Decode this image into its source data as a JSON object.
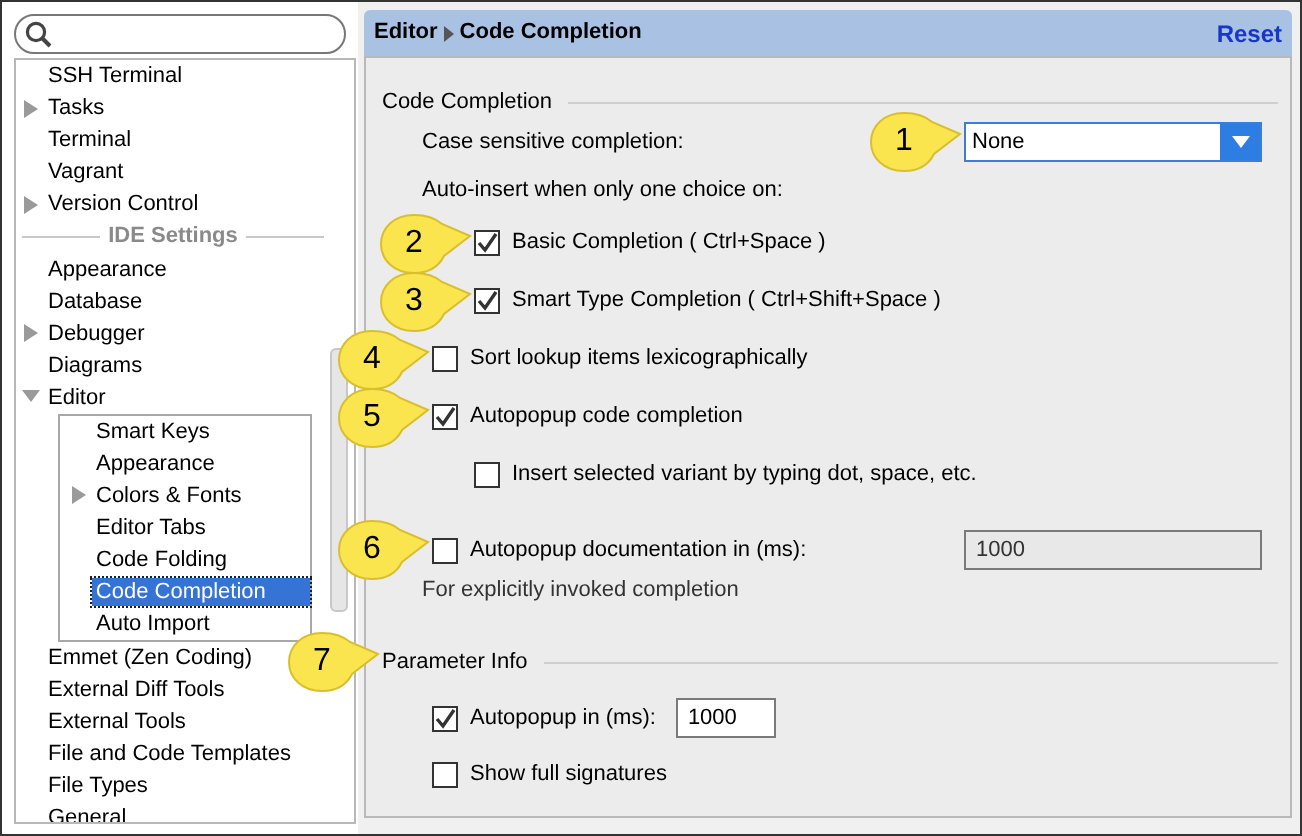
{
  "sidebar": {
    "items": [
      {
        "kind": "item",
        "label": "SSH Terminal",
        "selected": false
      },
      {
        "kind": "item",
        "label": "Tasks",
        "expanded": false,
        "selected": false
      },
      {
        "kind": "item",
        "label": "Terminal",
        "selected": false
      },
      {
        "kind": "item",
        "label": "Vagrant",
        "selected": false
      },
      {
        "kind": "item",
        "label": "Version Control",
        "expanded": false,
        "selected": false
      },
      {
        "kind": "heading",
        "label": "IDE Settings"
      },
      {
        "kind": "item",
        "label": "Appearance",
        "selected": false
      },
      {
        "kind": "item",
        "label": "Database",
        "selected": false
      },
      {
        "kind": "item",
        "label": "Debugger",
        "expanded": false,
        "selected": false
      },
      {
        "kind": "item",
        "label": "Diagrams",
        "selected": false
      },
      {
        "kind": "item",
        "label": "Editor",
        "expanded": true,
        "selected": false,
        "children": [
          {
            "kind": "item",
            "label": "Smart Keys",
            "selected": false
          },
          {
            "kind": "item",
            "label": "Appearance",
            "selected": false
          },
          {
            "kind": "item",
            "label": "Colors & Fonts",
            "expanded": false,
            "selected": false
          },
          {
            "kind": "item",
            "label": "Editor Tabs",
            "selected": false
          },
          {
            "kind": "item",
            "label": "Code Folding",
            "selected": false
          },
          {
            "kind": "item",
            "label": "Code Completion",
            "selected": true
          },
          {
            "kind": "item",
            "label": "Auto Import",
            "selected": false
          }
        ]
      },
      {
        "kind": "item",
        "label": "Emmet (Zen Coding)",
        "selected": false
      },
      {
        "kind": "item",
        "label": "External Diff Tools",
        "selected": false
      },
      {
        "kind": "item",
        "label": "External Tools",
        "selected": false
      },
      {
        "kind": "item",
        "label": "File and Code Templates",
        "selected": false
      },
      {
        "kind": "item",
        "label": "File Types",
        "selected": false
      },
      {
        "kind": "item",
        "label": "General",
        "selected": false
      }
    ]
  },
  "header": {
    "breadcrumb": [
      "Editor",
      "Code Completion"
    ],
    "reset": "Reset"
  },
  "sections": [
    {
      "title": "Code Completion",
      "items": [
        {
          "kind": "dropdown",
          "label": "Case sensitive completion:",
          "value": "None",
          "callout": "1"
        },
        {
          "kind": "label",
          "label": "Auto-insert when only one choice on:",
          "children": [
            {
              "kind": "checkbox",
              "label": "Basic Completion ( Ctrl+Space )",
              "checked": true,
              "callout": "2"
            },
            {
              "kind": "checkbox",
              "label": "Smart Type Completion ( Ctrl+Shift+Space )",
              "checked": true,
              "callout": "3"
            }
          ]
        },
        {
          "kind": "checkbox",
          "label": "Sort lookup items lexicographically",
          "checked": false,
          "callout": "4"
        },
        {
          "kind": "checkbox",
          "label": "Autopopup code completion",
          "checked": true,
          "callout": "5",
          "children": [
            {
              "kind": "checkbox",
              "label": "Insert selected variant by typing dot, space, etc.",
              "checked": false
            }
          ]
        },
        {
          "kind": "checkbox_field",
          "label": "Autopopup documentation in (ms):",
          "checked": false,
          "value": "1000",
          "disabled": true,
          "callout": "6"
        },
        {
          "kind": "hint",
          "label": "For explicitly invoked completion"
        }
      ]
    },
    {
      "title": "Parameter Info",
      "callout": "7",
      "items": [
        {
          "kind": "checkbox_inline_field",
          "label": "Autopopup in (ms):",
          "checked": true,
          "value": "1000",
          "disabled": false
        },
        {
          "kind": "checkbox",
          "label": "Show full signatures",
          "checked": false
        }
      ]
    }
  ]
}
